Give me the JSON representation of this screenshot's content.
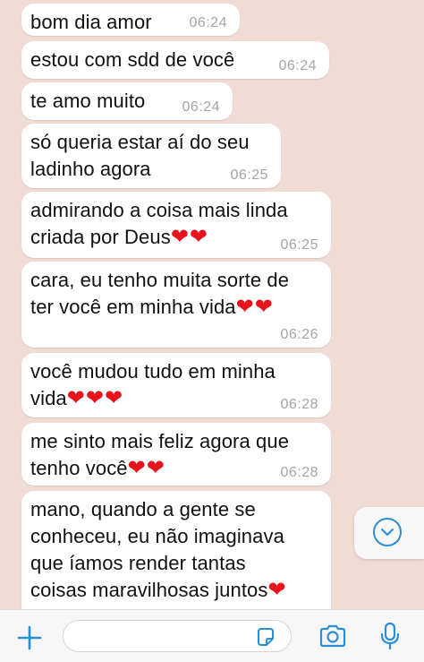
{
  "messages": [
    {
      "text": "bom dia amor",
      "time": "06:24"
    },
    {
      "text": "estou com sdd de você",
      "time": "06:24"
    },
    {
      "text": "te amo muito",
      "time": "06:24"
    },
    {
      "text": "só queria estar aí do seu\nladinho agora",
      "time": "06:25"
    },
    {
      "text": "admirando a coisa mais linda\ncriada por Deus",
      "hearts": "❤❤",
      "time": "06:25"
    },
    {
      "text": "cara, eu tenho muita sorte de\nter você em minha vida",
      "hearts": "❤❤",
      "time": "06:26"
    },
    {
      "text": "você mudou tudo em minha\nvida",
      "hearts": "❤❤❤",
      "time": "06:28"
    },
    {
      "text": "me sinto mais feliz agora que\ntenho você",
      "hearts": "❤❤",
      "time": "06:28"
    },
    {
      "text": "mano, quando a gente se\nconheceu, eu não imaginava\nque íamos render tantas\ncoisas maravilhosas juntos",
      "hearts": "❤"
    }
  ],
  "input_bar": {
    "icons": [
      "plus-icon",
      "sticker-icon",
      "camera-icon",
      "microphone-icon"
    ],
    "accent_color": "#2d8ed8"
  },
  "scroll_button": {
    "icon": "chevron-down-icon"
  },
  "colors": {
    "background": "#f0dcd4",
    "bubble": "#ffffff",
    "heart": "#e8141c",
    "accent": "#2d8ed8"
  }
}
